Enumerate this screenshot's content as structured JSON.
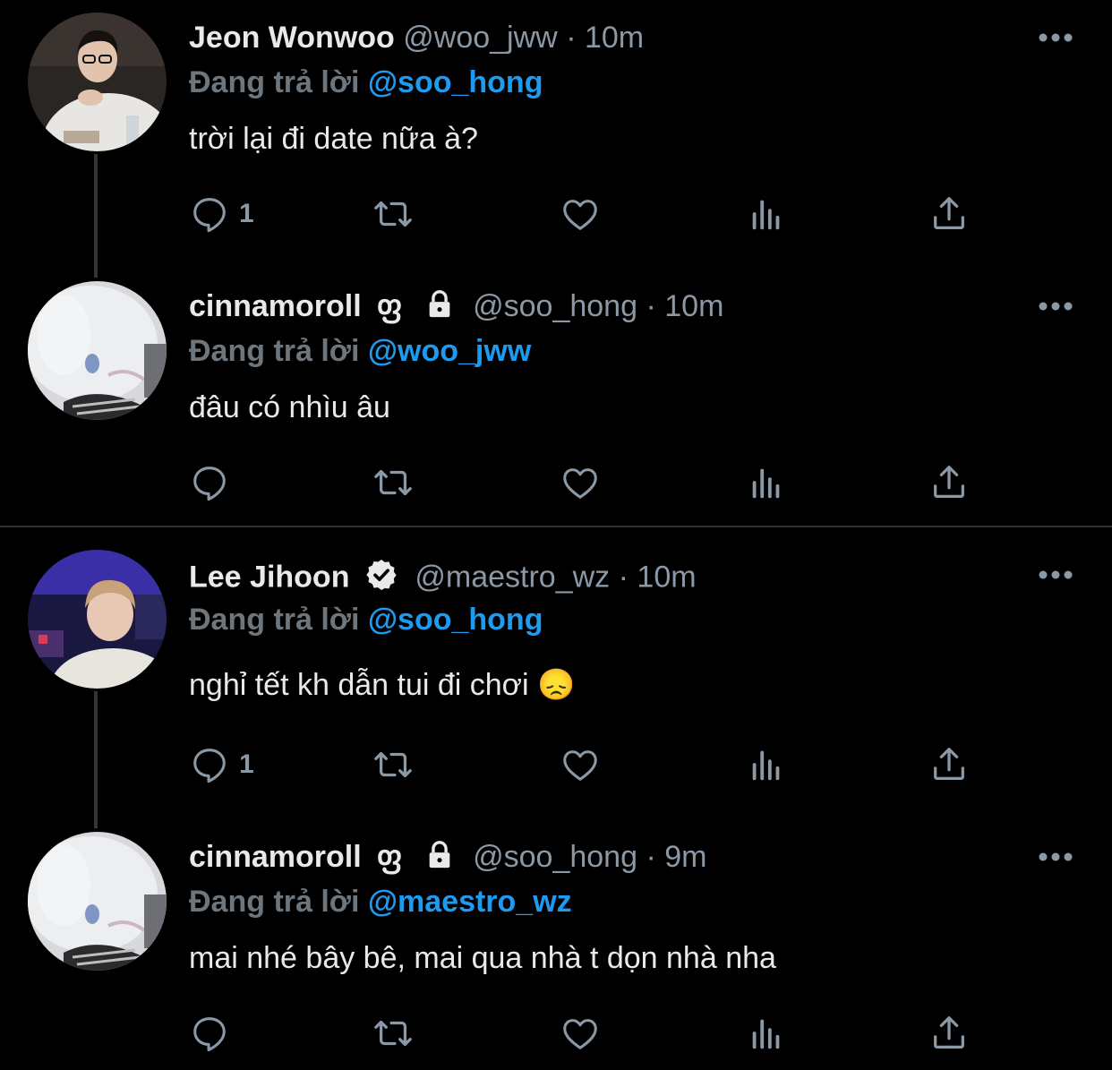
{
  "tweets": [
    {
      "name": "Jeon Wonwoo",
      "handle": "@woo_jww",
      "time": "10m",
      "replying_label": "Đang trả lời",
      "replying_to": "@soo_hong",
      "text": "trời lại đi date nữa à?",
      "reply_count": "1",
      "badges": []
    },
    {
      "name": "cinnamoroll",
      "decor": "ფ",
      "handle": "@soo_hong",
      "time": "10m",
      "replying_label": "Đang trả lời",
      "replying_to": "@woo_jww",
      "text": "đâu có nhìu âu",
      "reply_count": "",
      "badges": [
        "lock-icon"
      ]
    },
    {
      "name": "Lee Jihoon",
      "handle": "@maestro_wz",
      "time": "10m",
      "replying_label": "Đang trả lời",
      "replying_to": "@soo_hong",
      "text": "nghỉ tết kh dẫn tui đi chơi 😞",
      "reply_count": "1",
      "badges": [
        "verified-icon"
      ]
    },
    {
      "name": "cinnamoroll",
      "decor": "ფ",
      "handle": "@soo_hong",
      "time": "9m",
      "replying_label": "Đang trả lời",
      "replying_to": "@maestro_wz",
      "text": "mai nhé bây bê, mai qua nhà t dọn nhà nha",
      "reply_count": "",
      "badges": [
        "lock-icon"
      ]
    }
  ],
  "colors": {
    "background": "#000000",
    "name": "#e7e9ea",
    "secondary": "#8b98a5",
    "mention": "#1d9bf0",
    "replying": "#6e767d"
  }
}
